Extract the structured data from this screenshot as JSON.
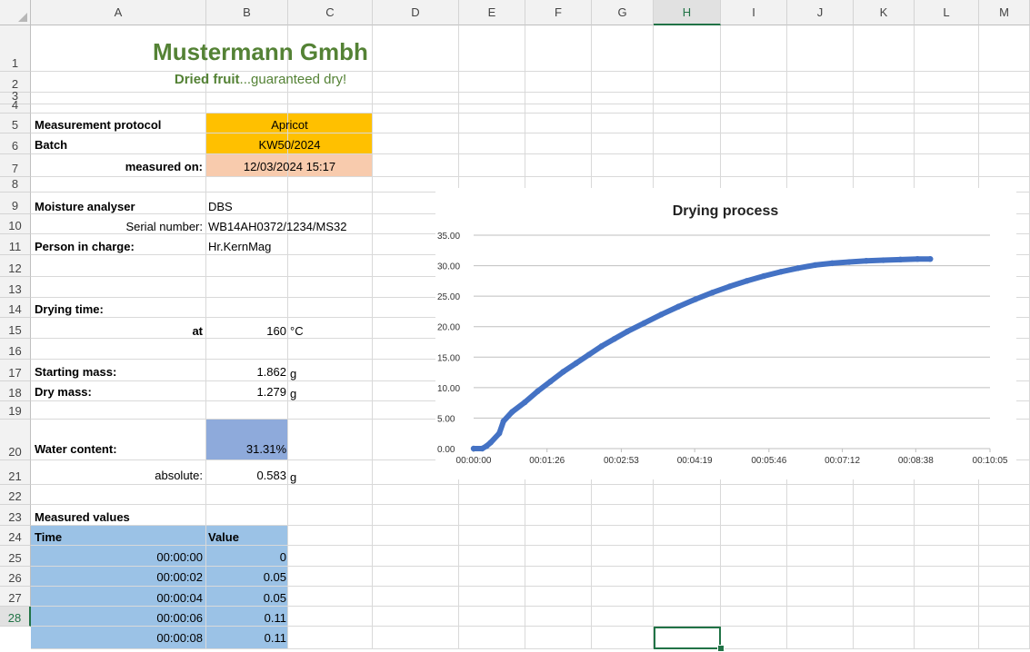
{
  "columns": [
    "A",
    "B",
    "C",
    "D",
    "E",
    "F",
    "G",
    "H",
    "I",
    "J",
    "K",
    "L",
    "M"
  ],
  "selected_column": "H",
  "rows": [
    "1",
    "2",
    "3",
    "4",
    "5",
    "6",
    "7",
    "8",
    "9",
    "10",
    "11",
    "12",
    "13",
    "14",
    "15",
    "16",
    "17",
    "18",
    "19",
    "20",
    "21",
    "22",
    "23",
    "24",
    "25",
    "26",
    "27",
    "28"
  ],
  "selected_row": "28",
  "company": {
    "name": "Mustermann Gmbh",
    "slogan_bold": "Dried fruit",
    "slogan_rest": "...guaranteed dry!"
  },
  "protocol": {
    "label": "Measurement protocol",
    "value": "Apricot",
    "batch_label": "Batch",
    "batch_value": "KW50/2024",
    "measured_on_label": "measured on:",
    "measured_on_value": "12/03/2024 15:17"
  },
  "analyser": {
    "label": "Moisture analyser",
    "value": "DBS",
    "serial_label": "Serial number:",
    "serial_value": "WB14AH0372/1234/MS32",
    "person_label": "Person in charge:",
    "person_value": "Hr.KernMag"
  },
  "drying": {
    "time_label": "Drying time:",
    "at_label": "at",
    "temperature": "160",
    "temperature_unit": "°C",
    "starting_mass_label": "Starting mass:",
    "starting_mass": "1.862",
    "dry_mass_label": "Dry mass:",
    "dry_mass": "1.279",
    "mass_unit": "g",
    "water_content_label": "Water content:",
    "water_content": "31.31%",
    "absolute_label": "absolute:",
    "absolute": "0.583",
    "absolute_unit": "g"
  },
  "measured": {
    "title": "Measured values",
    "time_header": "Time",
    "value_header": "Value",
    "rows": [
      {
        "time": "00:00:00",
        "value": "0"
      },
      {
        "time": "00:00:02",
        "value": "0.05"
      },
      {
        "time": "00:00:04",
        "value": "0.05"
      },
      {
        "time": "00:00:06",
        "value": "0.11"
      },
      {
        "time": "00:00:08",
        "value": "0.11"
      }
    ]
  },
  "colors": {
    "title_green": "#548235",
    "orange": "#ffc000",
    "peach": "#f8cbad",
    "water_blue": "#8eaadb",
    "table_blue": "#9bc2e6",
    "series_blue": "#4472c4",
    "selection_green": "#217346"
  },
  "chart_data": {
    "type": "scatter",
    "title": "Drying process",
    "xlabel": "",
    "ylabel": "",
    "x_ticks": [
      "00:00:00",
      "00:01:26",
      "00:02:53",
      "00:04:19",
      "00:05:46",
      "00:07:12",
      "00:08:38",
      "00:10:05"
    ],
    "y_ticks": [
      "0.00",
      "5.00",
      "10.00",
      "15.00",
      "20.00",
      "25.00",
      "30.00",
      "35.00"
    ],
    "xlim": [
      "00:00:00",
      "00:10:05"
    ],
    "ylim": [
      0,
      35
    ],
    "grid": true,
    "legend": "none",
    "series": [
      {
        "x": [
          "00:00:00",
          "00:00:10",
          "00:00:15",
          "00:00:20",
          "00:00:30",
          "00:00:35",
          "00:00:45",
          "00:01:00",
          "00:01:15",
          "00:01:30",
          "00:01:45",
          "00:02:00",
          "00:02:15",
          "00:02:30",
          "00:02:45",
          "00:03:00",
          "00:03:20",
          "00:03:40",
          "00:04:00",
          "00:04:20",
          "00:04:40",
          "00:05:00",
          "00:05:20",
          "00:05:40",
          "00:06:00",
          "00:06:20",
          "00:06:40",
          "00:07:00",
          "00:07:20",
          "00:07:40",
          "00:08:00",
          "00:08:20",
          "00:08:40",
          "00:08:55"
        ],
        "y": [
          0,
          0,
          0.4,
          1.0,
          2.5,
          4.5,
          6.0,
          7.6,
          9.4,
          11.0,
          12.6,
          14.0,
          15.4,
          16.8,
          18.0,
          19.2,
          20.6,
          22.0,
          23.3,
          24.5,
          25.6,
          26.6,
          27.5,
          28.3,
          29.0,
          29.6,
          30.1,
          30.4,
          30.6,
          30.8,
          30.9,
          31.0,
          31.1,
          31.1
        ]
      }
    ]
  }
}
